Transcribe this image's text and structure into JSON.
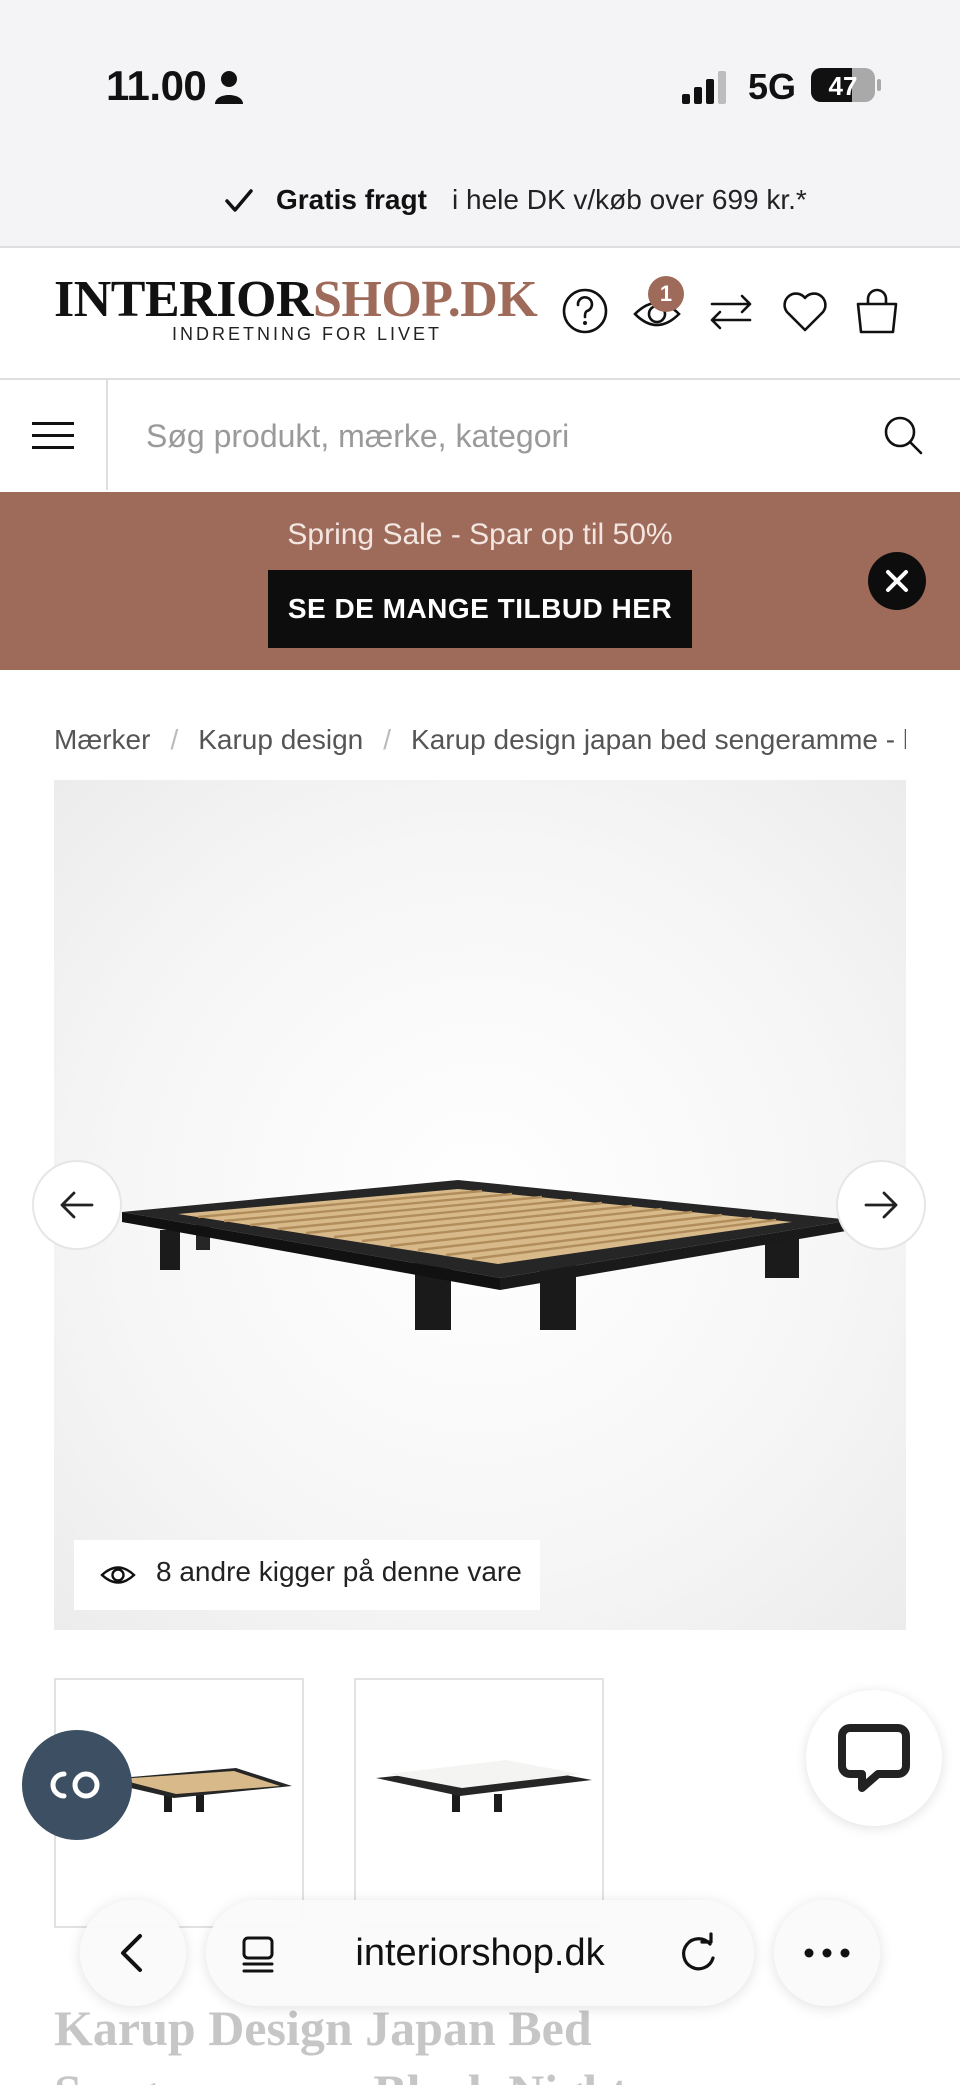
{
  "status_bar": {
    "time": "11.00",
    "network": "5G",
    "battery": "47"
  },
  "shipping": {
    "bold": "Gratis fragt",
    "rest": "i hele DK v/køb over 699 kr.*"
  },
  "header": {
    "logo_part1": "INTERIOR",
    "logo_part2": "SHOP.DK",
    "tagline": "INDRETNING FOR LIVET",
    "recent_count": "1"
  },
  "search": {
    "placeholder": "Søg produkt, mærke, kategori",
    "value": ""
  },
  "promo": {
    "text": "Spring Sale - Spar op til 50%",
    "button": "SE DE MANGE TILBUD HER"
  },
  "breadcrumb": [
    "Mærker",
    "Karup design",
    "Karup design japan bed sengeramme - b"
  ],
  "gallery": {
    "viewers_text": "8 andre kigger på denne vare"
  },
  "product": {
    "title": "Karup Design Japan Bed",
    "title_line2": "Sengeramme - Black Night"
  },
  "browser": {
    "url": "interiorshop.dk"
  },
  "colors": {
    "accent": "#9e6a5a",
    "promo_bg": "#9e6a5a",
    "dark": "#0d0d0d",
    "co_button": "#3d4f63"
  }
}
